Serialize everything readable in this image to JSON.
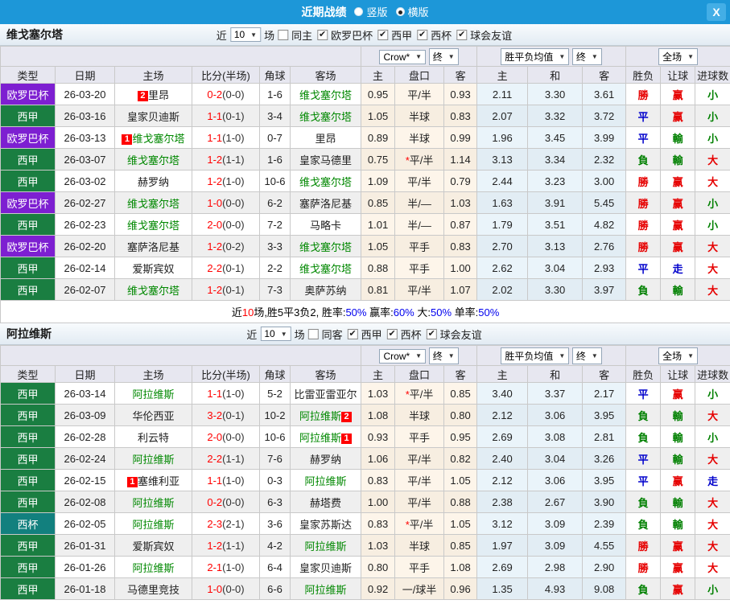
{
  "titlebar": {
    "title": "近期战绩",
    "radios": [
      {
        "label": "竖版",
        "checked": false
      },
      {
        "label": "横版",
        "checked": true
      }
    ],
    "close_label": "X"
  },
  "columns": [
    "类型",
    "日期",
    "主场",
    "比分(半场)",
    "角球",
    "客场",
    "主",
    "盘口",
    "客",
    "主",
    "和",
    "客",
    "胜负",
    "让球",
    "进球数"
  ],
  "dropdowns": {
    "bookmaker": "Crow*",
    "final1": "终",
    "average": "胜平负均值",
    "final2": "终",
    "scope": "全场"
  },
  "colors": {
    "titlebar_bg": "#1d97d8",
    "league_colors": {
      "欧罗巴杯": "#7d1fd1",
      "西甲": "#1a7e41",
      "西杯": "#12807e"
    },
    "team_green": "#008800",
    "score_red": "#ff0000",
    "result_colors": {
      "勝": "#e60000",
      "赢": "#e60000",
      "大": "#e60000",
      "平": "#0000cc",
      "走": "#0000cc",
      "負": "#008000",
      "輸": "#008000",
      "小": "#008000"
    },
    "summary_palette": {
      "k": "#000000",
      "r": "#ff0000",
      "b": "#0000ee"
    }
  },
  "sections": [
    {
      "team": "维戈塞尔塔",
      "filter": {
        "prefix": "近",
        "count": "10",
        "suffix": "场",
        "same": "同主",
        "same_checked": false,
        "leagues": [
          "欧罗巴杯",
          "西甲",
          "西杯",
          "球会友谊"
        ]
      },
      "rows": [
        {
          "league": "欧罗巴杯",
          "date": "26-03-20",
          "home": {
            "name": "里昂",
            "badge": "2"
          },
          "score": [
            "0-2",
            "(0-0)"
          ],
          "corners": "1-6",
          "away": {
            "name": "维戈塞尔塔",
            "green": true
          },
          "asian": {
            "h": "0.95",
            "line": "平/半",
            "a": "0.93"
          },
          "euro": [
            "2.11",
            "3.30",
            "3.61"
          ],
          "res": [
            "勝",
            "赢",
            "小"
          ]
        },
        {
          "league": "西甲",
          "date": "26-03-16",
          "home": {
            "name": "皇家贝迪斯"
          },
          "score": [
            "1-1",
            "(0-1)"
          ],
          "corners": "3-4",
          "away": {
            "name": "维戈塞尔塔",
            "green": true
          },
          "asian": {
            "h": "1.05",
            "line": "半球",
            "a": "0.83"
          },
          "euro": [
            "2.07",
            "3.32",
            "3.72"
          ],
          "res": [
            "平",
            "赢",
            "小"
          ]
        },
        {
          "league": "欧罗巴杯",
          "date": "26-03-13",
          "home": {
            "name": "维戈塞尔塔",
            "green": true,
            "badge": "1"
          },
          "score": [
            "1-1",
            "(1-0)"
          ],
          "corners": "0-7",
          "away": {
            "name": "里昂"
          },
          "asian": {
            "h": "0.89",
            "line": "半球",
            "a": "0.99"
          },
          "euro": [
            "1.96",
            "3.45",
            "3.99"
          ],
          "res": [
            "平",
            "輸",
            "小"
          ]
        },
        {
          "league": "西甲",
          "date": "26-03-07",
          "home": {
            "name": "维戈塞尔塔",
            "green": true
          },
          "score": [
            "1-2",
            "(1-1)"
          ],
          "corners": "1-6",
          "away": {
            "name": "皇家马德里"
          },
          "asian": {
            "h": "0.75",
            "line": "平/半",
            "star": true,
            "a": "1.14"
          },
          "euro": [
            "3.13",
            "3.34",
            "2.32"
          ],
          "res": [
            "負",
            "輸",
            "大"
          ]
        },
        {
          "league": "西甲",
          "date": "26-03-02",
          "home": {
            "name": "赫罗纳"
          },
          "score": [
            "1-2",
            "(1-0)"
          ],
          "corners": "10-6",
          "away": {
            "name": "维戈塞尔塔",
            "green": true
          },
          "asian": {
            "h": "1.09",
            "line": "平/半",
            "a": "0.79"
          },
          "euro": [
            "2.44",
            "3.23",
            "3.00"
          ],
          "res": [
            "勝",
            "赢",
            "大"
          ]
        },
        {
          "league": "欧罗巴杯",
          "date": "26-02-27",
          "home": {
            "name": "维戈塞尔塔",
            "green": true
          },
          "score": [
            "1-0",
            "(0-0)"
          ],
          "corners": "6-2",
          "away": {
            "name": "塞萨洛尼基"
          },
          "asian": {
            "h": "0.85",
            "line": "半/—",
            "a": "1.03"
          },
          "euro": [
            "1.63",
            "3.91",
            "5.45"
          ],
          "res": [
            "勝",
            "赢",
            "小"
          ]
        },
        {
          "league": "西甲",
          "date": "26-02-23",
          "home": {
            "name": "维戈塞尔塔",
            "green": true
          },
          "score": [
            "2-0",
            "(0-0)"
          ],
          "corners": "7-2",
          "away": {
            "name": "马略卡"
          },
          "asian": {
            "h": "1.01",
            "line": "半/—",
            "a": "0.87"
          },
          "euro": [
            "1.79",
            "3.51",
            "4.82"
          ],
          "res": [
            "勝",
            "赢",
            "小"
          ]
        },
        {
          "league": "欧罗巴杯",
          "date": "26-02-20",
          "home": {
            "name": "塞萨洛尼基"
          },
          "score": [
            "1-2",
            "(0-2)"
          ],
          "corners": "3-3",
          "away": {
            "name": "维戈塞尔塔",
            "green": true
          },
          "asian": {
            "h": "1.05",
            "line": "平手",
            "a": "0.83"
          },
          "euro": [
            "2.70",
            "3.13",
            "2.76"
          ],
          "res": [
            "勝",
            "赢",
            "大"
          ]
        },
        {
          "league": "西甲",
          "date": "26-02-14",
          "home": {
            "name": "爱斯宾奴"
          },
          "score": [
            "2-2",
            "(0-1)"
          ],
          "corners": "2-2",
          "away": {
            "name": "维戈塞尔塔",
            "green": true
          },
          "asian": {
            "h": "0.88",
            "line": "平手",
            "a": "1.00"
          },
          "euro": [
            "2.62",
            "3.04",
            "2.93"
          ],
          "res": [
            "平",
            "走",
            "大"
          ]
        },
        {
          "league": "西甲",
          "date": "26-02-07",
          "home": {
            "name": "维戈塞尔塔",
            "green": true
          },
          "score": [
            "1-2",
            "(0-1)"
          ],
          "corners": "7-3",
          "away": {
            "name": "奥萨苏纳"
          },
          "asian": {
            "h": "0.81",
            "line": "平/半",
            "a": "1.07"
          },
          "euro": [
            "2.02",
            "3.30",
            "3.97"
          ],
          "res": [
            "負",
            "輸",
            "大"
          ]
        }
      ],
      "summary": [
        [
          "近",
          "k"
        ],
        [
          "10",
          "r"
        ],
        [
          "场,胜5平3负2, 胜率:",
          "k"
        ],
        [
          "50%",
          "b"
        ],
        [
          " 赢率:",
          "k"
        ],
        [
          "60%",
          "b"
        ],
        [
          " 大:",
          "k"
        ],
        [
          "50%",
          "b"
        ],
        [
          " 单率:",
          "k"
        ],
        [
          "50%",
          "b"
        ]
      ]
    },
    {
      "team": "阿拉维斯",
      "filter": {
        "prefix": "近",
        "count": "10",
        "suffix": "场",
        "same": "同客",
        "same_checked": false,
        "leagues": [
          "西甲",
          "西杯",
          "球会友谊"
        ]
      },
      "rows": [
        {
          "league": "西甲",
          "date": "26-03-14",
          "home": {
            "name": "阿拉维斯",
            "green": true
          },
          "score": [
            "1-1",
            "(1-0)"
          ],
          "corners": "5-2",
          "away": {
            "name": "比雷亚雷亚尔"
          },
          "asian": {
            "h": "1.03",
            "line": "平/半",
            "star": true,
            "a": "0.85"
          },
          "euro": [
            "3.40",
            "3.37",
            "2.17"
          ],
          "res": [
            "平",
            "赢",
            "小"
          ]
        },
        {
          "league": "西甲",
          "date": "26-03-09",
          "home": {
            "name": "华伦西亚"
          },
          "score": [
            "3-2",
            "(0-1)"
          ],
          "corners": "10-2",
          "away": {
            "name": "阿拉维斯",
            "green": true,
            "badge": "2"
          },
          "asian": {
            "h": "1.08",
            "line": "半球",
            "a": "0.80"
          },
          "euro": [
            "2.12",
            "3.06",
            "3.95"
          ],
          "res": [
            "負",
            "輸",
            "大"
          ]
        },
        {
          "league": "西甲",
          "date": "26-02-28",
          "home": {
            "name": "利云特"
          },
          "score": [
            "2-0",
            "(0-0)"
          ],
          "corners": "10-6",
          "away": {
            "name": "阿拉维斯",
            "green": true,
            "badge": "1"
          },
          "asian": {
            "h": "0.93",
            "line": "平手",
            "a": "0.95"
          },
          "euro": [
            "2.69",
            "3.08",
            "2.81"
          ],
          "res": [
            "負",
            "輸",
            "小"
          ]
        },
        {
          "league": "西甲",
          "date": "26-02-24",
          "home": {
            "name": "阿拉维斯",
            "green": true
          },
          "score": [
            "2-2",
            "(1-1)"
          ],
          "corners": "7-6",
          "away": {
            "name": "赫罗纳"
          },
          "asian": {
            "h": "1.06",
            "line": "平/半",
            "a": "0.82"
          },
          "euro": [
            "2.40",
            "3.04",
            "3.26"
          ],
          "res": [
            "平",
            "輸",
            "大"
          ]
        },
        {
          "league": "西甲",
          "date": "26-02-15",
          "home": {
            "name": "塞维利亚",
            "badge": "1"
          },
          "score": [
            "1-1",
            "(1-0)"
          ],
          "corners": "0-3",
          "away": {
            "name": "阿拉维斯",
            "green": true
          },
          "asian": {
            "h": "0.83",
            "line": "平/半",
            "a": "1.05"
          },
          "euro": [
            "2.12",
            "3.06",
            "3.95"
          ],
          "res": [
            "平",
            "赢",
            "走"
          ]
        },
        {
          "league": "西甲",
          "date": "26-02-08",
          "home": {
            "name": "阿拉维斯",
            "green": true
          },
          "score": [
            "0-2",
            "(0-0)"
          ],
          "corners": "6-3",
          "away": {
            "name": "赫塔费"
          },
          "asian": {
            "h": "1.00",
            "line": "平/半",
            "a": "0.88"
          },
          "euro": [
            "2.38",
            "2.67",
            "3.90"
          ],
          "res": [
            "負",
            "輸",
            "大"
          ]
        },
        {
          "league": "西杯",
          "date": "26-02-05",
          "home": {
            "name": "阿拉维斯",
            "green": true
          },
          "score": [
            "2-3",
            "(2-1)"
          ],
          "corners": "3-6",
          "away": {
            "name": "皇家苏斯达"
          },
          "asian": {
            "h": "0.83",
            "line": "平/半",
            "star": true,
            "a": "1.05"
          },
          "euro": [
            "3.12",
            "3.09",
            "2.39"
          ],
          "res": [
            "負",
            "輸",
            "大"
          ]
        },
        {
          "league": "西甲",
          "date": "26-01-31",
          "home": {
            "name": "爱斯宾奴"
          },
          "score": [
            "1-2",
            "(1-1)"
          ],
          "corners": "4-2",
          "away": {
            "name": "阿拉维斯",
            "green": true
          },
          "asian": {
            "h": "1.03",
            "line": "半球",
            "a": "0.85"
          },
          "euro": [
            "1.97",
            "3.09",
            "4.55"
          ],
          "res": [
            "勝",
            "赢",
            "大"
          ]
        },
        {
          "league": "西甲",
          "date": "26-01-26",
          "home": {
            "name": "阿拉维斯",
            "green": true
          },
          "score": [
            "2-1",
            "(1-0)"
          ],
          "corners": "6-4",
          "away": {
            "name": "皇家贝迪斯"
          },
          "asian": {
            "h": "0.80",
            "line": "平手",
            "a": "1.08"
          },
          "euro": [
            "2.69",
            "2.98",
            "2.90"
          ],
          "res": [
            "勝",
            "赢",
            "大"
          ]
        },
        {
          "league": "西甲",
          "date": "26-01-18",
          "home": {
            "name": "马德里竞技"
          },
          "score": [
            "1-0",
            "(0-0)"
          ],
          "corners": "6-6",
          "away": {
            "name": "阿拉维斯",
            "green": true
          },
          "asian": {
            "h": "0.92",
            "line": "一/球半",
            "a": "0.96"
          },
          "euro": [
            "1.35",
            "4.93",
            "9.08"
          ],
          "res": [
            "負",
            "赢",
            "小"
          ]
        }
      ]
    }
  ]
}
